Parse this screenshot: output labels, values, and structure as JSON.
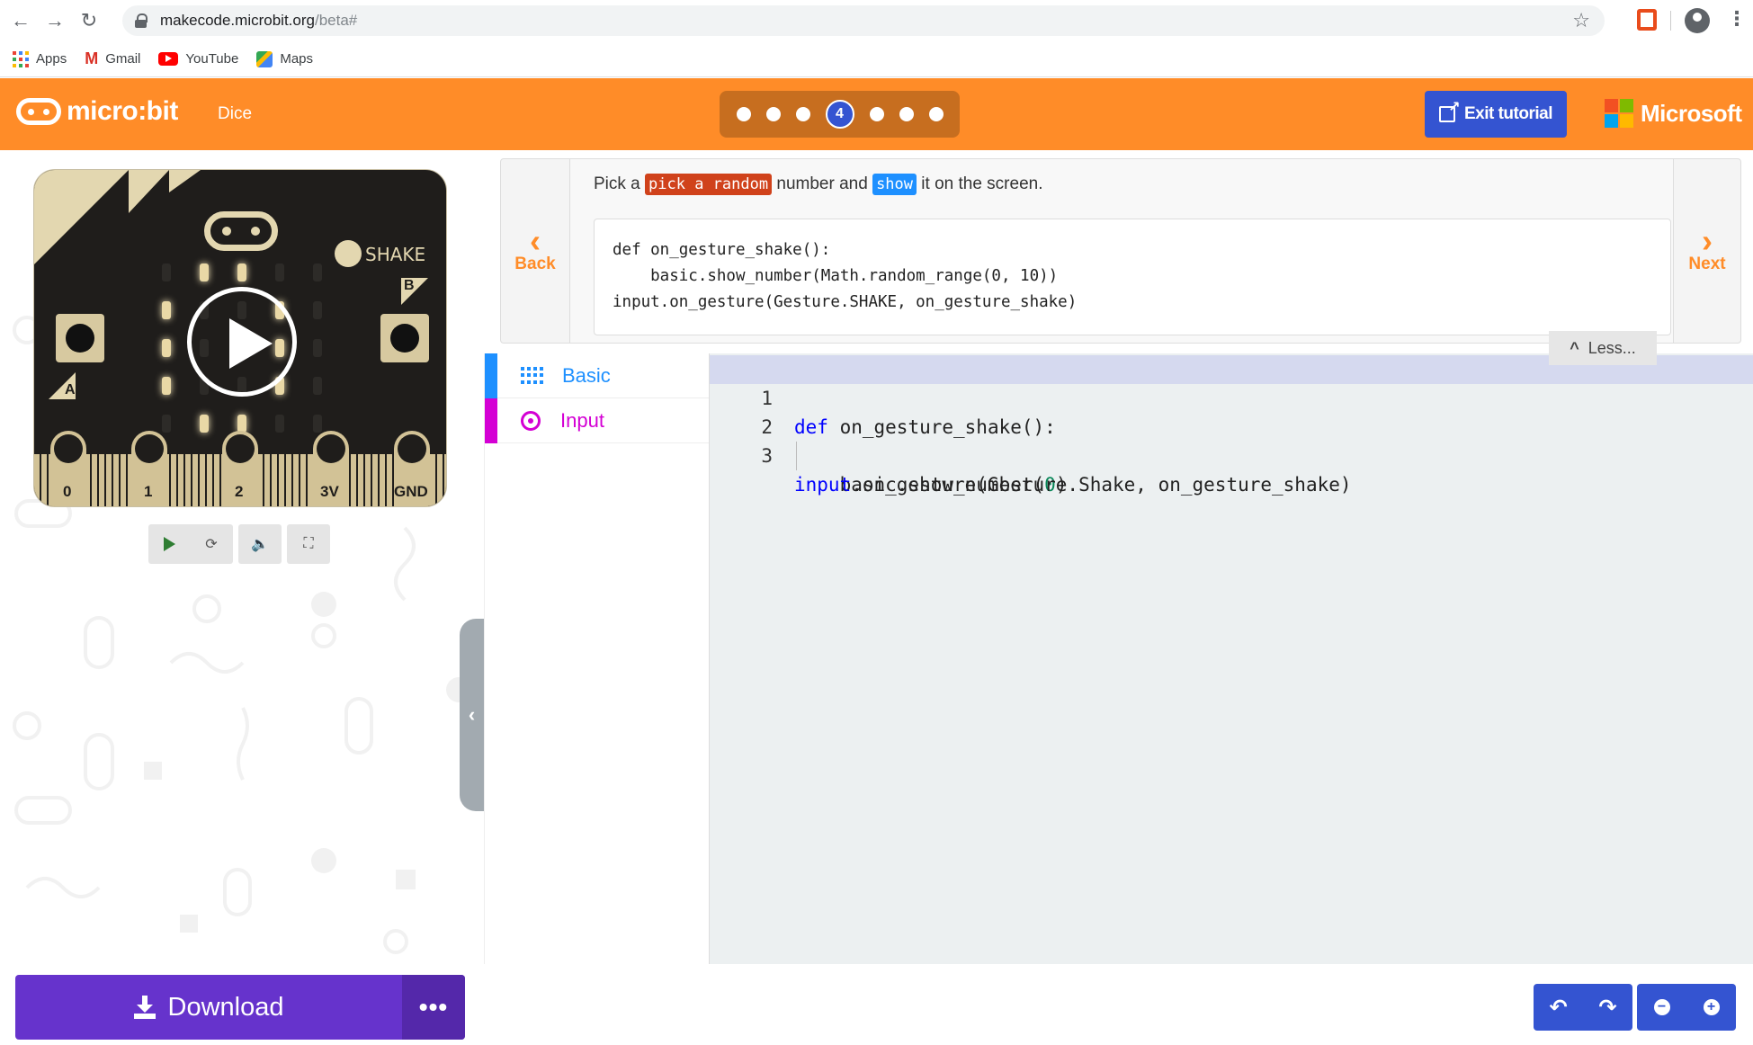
{
  "browser": {
    "url_host": "makecode.microbit.org",
    "url_path": "/beta#",
    "bookmarks": [
      "Apps",
      "Gmail",
      "YouTube",
      "Maps"
    ]
  },
  "header": {
    "logo_text": "micro:bit",
    "project_name": "Dice",
    "current_step": "4",
    "exit_label": "Exit tutorial",
    "brand": "Microsoft"
  },
  "simulator": {
    "shake_label": "SHAKE",
    "button_a": "A",
    "button_b": "B",
    "pins": [
      "0",
      "1",
      "2",
      "3V",
      "GND"
    ]
  },
  "tutorial": {
    "back_label": "Back",
    "next_label": "Next",
    "text_before": "Pick a ",
    "keyword1": "pick a random",
    "text_middle": " number and ",
    "keyword2": "show",
    "text_after": " it on the screen.",
    "code_lines": [
      "def on_gesture_shake():",
      "    basic.show_number(Math.random_range(0, 10))",
      "input.on_gesture(Gesture.SHAKE, on_gesture_shake)"
    ],
    "less_label": "Less..."
  },
  "toolbox": {
    "categories": [
      {
        "label": "Basic",
        "color": "#1e90ff"
      },
      {
        "label": "Input",
        "color": "#d400d4"
      }
    ]
  },
  "editor": {
    "line_numbers": [
      "1",
      "2",
      "3"
    ],
    "line1": {
      "kw": "def",
      "rest": " on_gesture_shake():"
    },
    "line2": {
      "pre": "    basic.show_number(",
      "num": "0",
      "post": ")"
    },
    "line3": {
      "kw": "input",
      "rest": ".on_gesture(Gesture.Shake, on_gesture_shake)"
    }
  },
  "footer": {
    "download_label": "Download",
    "more_label": "•••"
  },
  "colors": {
    "accent": "#ff8c28",
    "primary": "#3454d1",
    "download": "#6633cc"
  }
}
